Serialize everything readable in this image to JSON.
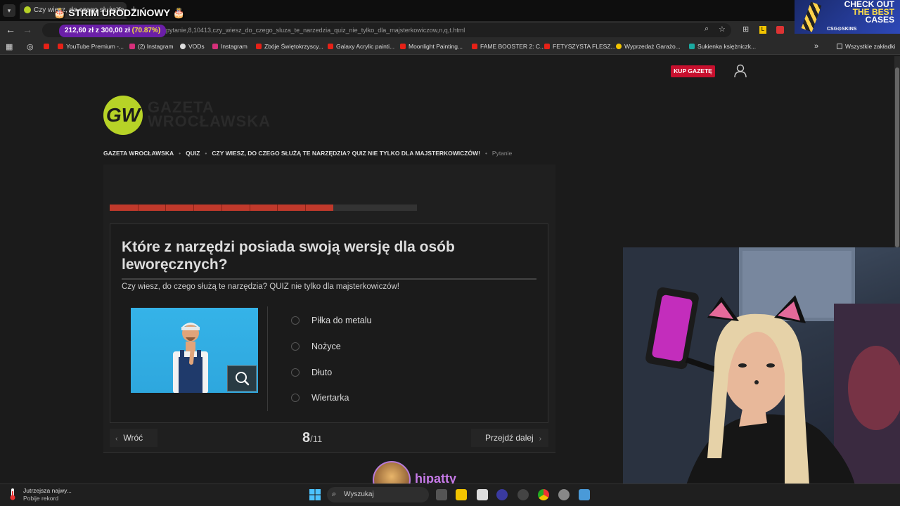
{
  "browser": {
    "tab_title": "Czy wiesz, do czego służą te...",
    "overlay_title": "🎂 STRIM URODZIŃOWY 🎂",
    "url": "pytanie,8,10413,czy_wiesz_do_czego_sluza_te_narzedzia_quiz_nie_tylko_dla_majsterkowiczow,n,q,t.html",
    "donation": {
      "amount": "212,60 zł z 300,00 zł",
      "percent": "(70.87%)"
    },
    "bookmarks": [
      {
        "label": "YouTube Premium -...",
        "color": "#e62117"
      },
      {
        "label": "(2) Instagram",
        "color": "#d6307b"
      },
      {
        "label": "VODs",
        "color": "#dddddd"
      },
      {
        "label": "Instagram",
        "color": "#d6307b"
      },
      {
        "label": "Zbóje Świętokrzyscy...",
        "color": "#e62117"
      },
      {
        "label": "Galaxy Acrylic painti...",
        "color": "#e62117"
      },
      {
        "label": "Moonlight Painting...",
        "color": "#e62117"
      },
      {
        "label": "FAME BOOSTER 2: C...",
        "color": "#e62117"
      },
      {
        "label": "FETYSZYSTA FLESZ...",
        "color": "#e62117"
      },
      {
        "label": "Wyprzedaż Garażo...",
        "color": "#f2c400"
      },
      {
        "label": "Sukienka księżniczk...",
        "color": "#1aa9a0"
      }
    ],
    "all_bookmarks": "Wszystkie zakładki"
  },
  "ad": {
    "line1": "CHECK OUT",
    "line2": "THE BEST",
    "line3": "CASES",
    "brand": "CSG⊙SKINS"
  },
  "header": {
    "buy_label": "KUP GAZETĘ",
    "logo_mark": "GW",
    "logo_line1": "GAZETA",
    "logo_line2": "WROCŁAWSKA"
  },
  "breadcrumb": [
    "GAZETA WROCŁAWSKA",
    "QUIZ",
    "CZY WIESZ, DO CZEGO SŁUŻĄ TE NARZĘDZIA? QUIZ NIE TYLKO DLA MAJSTERKOWICZÓW!",
    "Pytanie"
  ],
  "quiz": {
    "question": "Które z narzędzi posiada swoją wersję dla osób leworęcznych?",
    "subtitle": "Czy wiesz, do czego służą te narzędzia? QUIZ nie tylko dla majsterkowiczów!",
    "answers": [
      "Piłka do metalu",
      "Nożyce",
      "Dłuto",
      "Wiertarka"
    ],
    "current": "8",
    "total": "/11",
    "progress_fraction": 0.727,
    "back_label": "Wróć",
    "next_label": "Przejdź dalej",
    "accent_color": "#c0392b"
  },
  "stream": {
    "name": "hipatty"
  },
  "taskbar": {
    "weather_line1": "Jutrzejsza najwy...",
    "weather_line2": "Pobije rekord",
    "search_label": "Wyszukaj"
  }
}
